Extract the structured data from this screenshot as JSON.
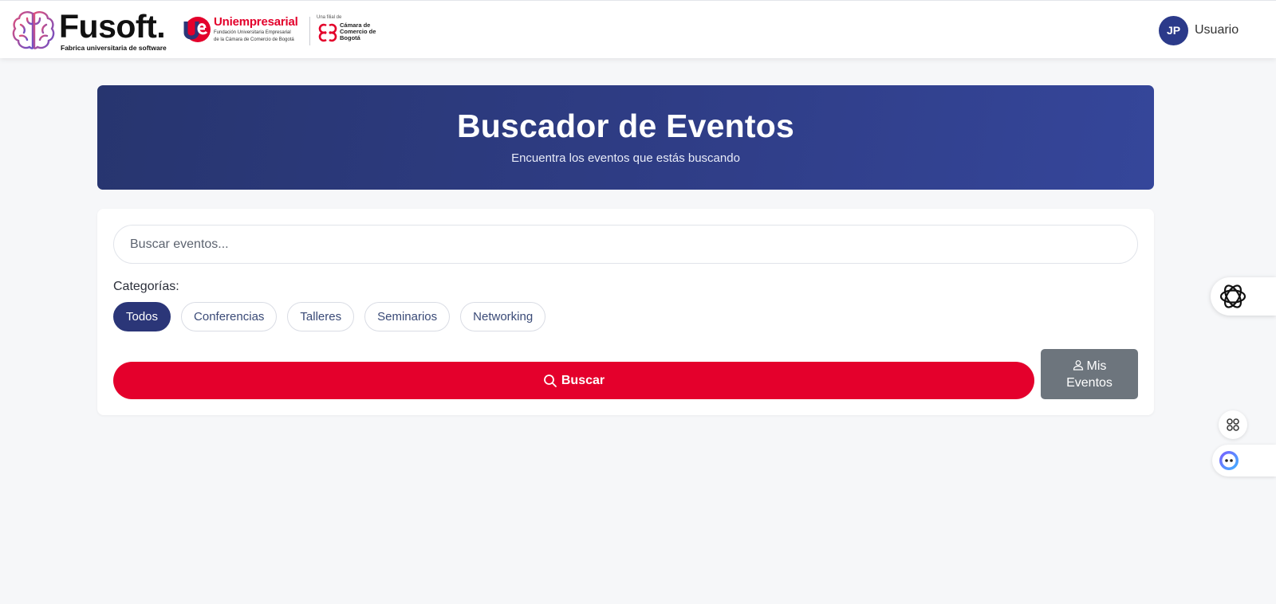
{
  "header": {
    "brand_name": "Fusoft.",
    "brand_tagline": "Fabrica universitaria de software",
    "partner_name": "Uniempresarial",
    "partner_sub1": "Fundación Universitaria Empresarial",
    "partner_sub2": "de la Cámara de Comercio de Bogotá",
    "affiliate_note": "Una filial de",
    "affiliate_name": "Cámara de Comercio de Bogotá",
    "user_initials": "JP",
    "user_label": "Usuario"
  },
  "hero": {
    "title": "Buscador de Eventos",
    "subtitle": "Encuentra los eventos que estás buscando"
  },
  "search": {
    "placeholder": "Buscar eventos...",
    "value": "",
    "categories_label": "Categorías:",
    "categories": [
      "Todos",
      "Conferencias",
      "Talleres",
      "Seminarios",
      "Networking"
    ],
    "selected_category": "Todos",
    "search_button": "Buscar",
    "my_events_button": "Mis Eventos"
  },
  "colors": {
    "brand_navy": "#2b3678",
    "primary_red": "#e4002c",
    "secondary_gray": "#6d757d",
    "background": "#f6f7f9"
  },
  "icons": {
    "brand": "brain-icon",
    "search": "search-icon",
    "user": "user-icon",
    "float_widgets": [
      "chatgpt-icon",
      "apps-icon",
      "assistant-icon"
    ]
  }
}
